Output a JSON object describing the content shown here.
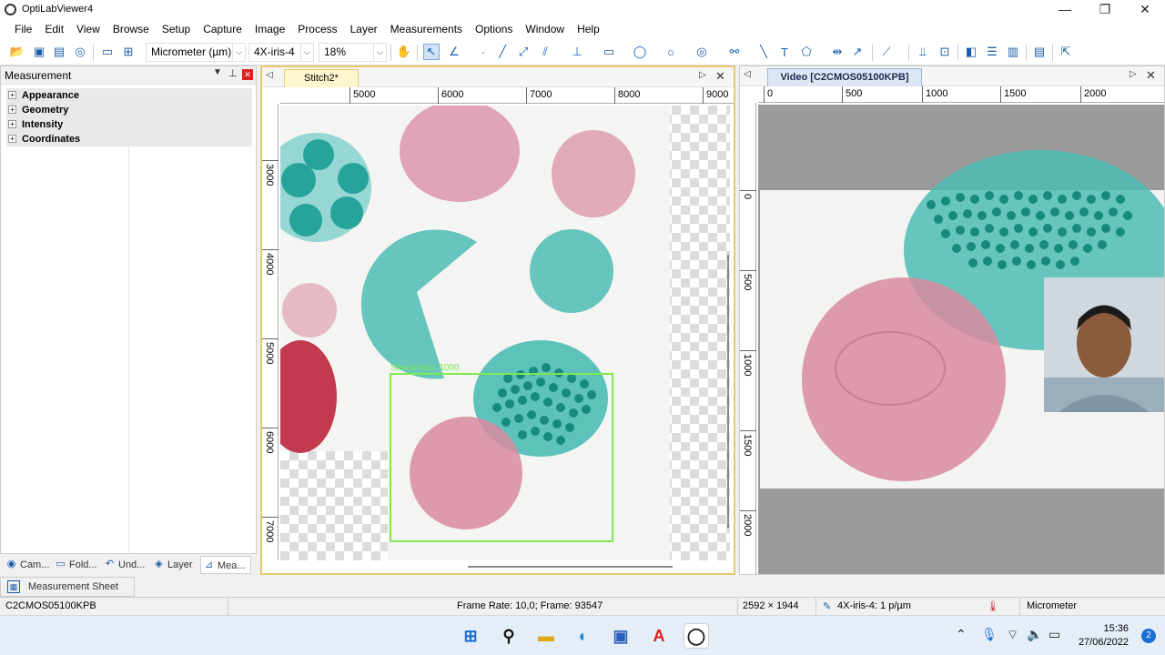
{
  "window": {
    "title": "OptiLabViewer4",
    "minimize": "—",
    "maximize": "❐",
    "close": "✕"
  },
  "menu": [
    "File",
    "Edit",
    "View",
    "Browse",
    "Setup",
    "Capture",
    "Image",
    "Process",
    "Layer",
    "Measurements",
    "Options",
    "Window",
    "Help"
  ],
  "toolbar": {
    "unit_select": "Micrometer (µm)",
    "objective_select": "4X-iris-4",
    "zoom_select": "18%"
  },
  "left_panel": {
    "title": "Measurement",
    "tree": [
      "Appearance",
      "Geometry",
      "Intensity",
      "Coordinates"
    ],
    "tabs": [
      "Cam...",
      "Fold...",
      "Und...",
      "Layer",
      "Mea..."
    ],
    "sheet_tab": "Measurement Sheet"
  },
  "doc1": {
    "tab": "Stitch2*",
    "ruler_h": [
      "5000",
      "6000",
      "7000",
      "8000",
      "9000"
    ],
    "ruler_v": [
      "3000",
      "4000",
      "5000",
      "6000",
      "7000"
    ],
    "roi_label": "Sharpness: 1000"
  },
  "doc2": {
    "tab": "Video [C2CMOS05100KPB]",
    "ruler_h": [
      "0",
      "500",
      "1000",
      "1500",
      "2000"
    ],
    "ruler_v": [
      "0",
      "500",
      "1000",
      "1500",
      "2000"
    ]
  },
  "status": {
    "camera": "C2CMOS05100KPB",
    "frame": "Frame Rate: 10,0; Frame: 93547",
    "resolution": "2592 × 1944",
    "calibration": "4X-iris-4: 1 p/µm",
    "unit": "Micrometer"
  },
  "taskbar": {
    "time": "15:36",
    "date": "27/06/2022",
    "notifications": "2"
  },
  "colors": {
    "pink_cell": "#d88aa0",
    "teal_cell": "#4cbcb4",
    "dark_teal": "#17897f",
    "red_cell": "#c23a4e",
    "roi": "#7ee84e",
    "tab_yellow": "#fff6cf"
  }
}
